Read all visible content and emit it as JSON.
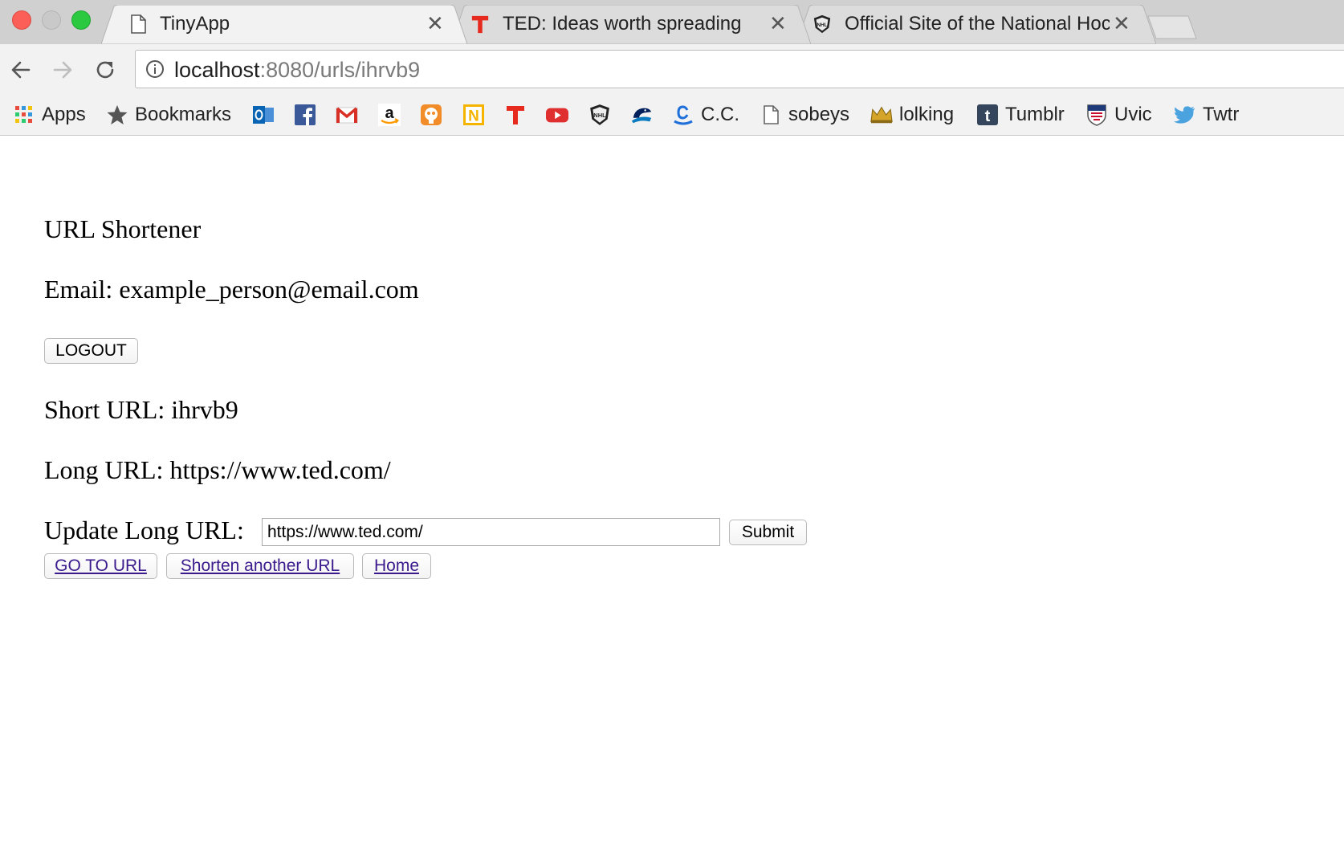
{
  "tabs": [
    {
      "title": "TinyApp",
      "icon": "page-icon",
      "active": true
    },
    {
      "title": "TED: Ideas worth spreading",
      "icon": "ted-icon",
      "active": false
    },
    {
      "title": "Official Site of the National Hoc",
      "icon": "nhl-icon",
      "active": false
    }
  ],
  "address_bar": {
    "host": "localhost",
    "rest": ":8080/urls/ihrvb9"
  },
  "bookmarks": [
    {
      "label": "Apps",
      "icon": "apps-grid-icon"
    },
    {
      "label": "Bookmarks",
      "icon": "star-icon"
    },
    {
      "label": "",
      "icon": "outlook-icon"
    },
    {
      "label": "",
      "icon": "facebook-icon"
    },
    {
      "label": "",
      "icon": "gmail-icon"
    },
    {
      "label": "",
      "icon": "amazon-icon"
    },
    {
      "label": "",
      "icon": "duolingo-icon"
    },
    {
      "label": "",
      "icon": "n-icon"
    },
    {
      "label": "",
      "icon": "ted-icon"
    },
    {
      "label": "",
      "icon": "youtube-icon"
    },
    {
      "label": "",
      "icon": "nhl-icon"
    },
    {
      "label": "",
      "icon": "canucks-icon"
    },
    {
      "label": "C.C.",
      "icon": "cc-icon"
    },
    {
      "label": "sobeys",
      "icon": "page-icon"
    },
    {
      "label": "lolking",
      "icon": "crown-icon"
    },
    {
      "label": "Tumblr",
      "icon": "tumblr-icon"
    },
    {
      "label": "Uvic",
      "icon": "uvic-icon"
    },
    {
      "label": "Twtr",
      "icon": "twitter-icon"
    }
  ],
  "page": {
    "heading": "URL Shortener",
    "email_line": "Email: example_person@email.com",
    "logout_label": "LOGOUT",
    "short_url_line": "Short URL: ihrvb9",
    "long_url_line": "Long URL: https://www.ted.com/",
    "update_label": "Update Long URL:",
    "update_value": "https://www.ted.com/",
    "submit_label": "Submit",
    "goto_label": "GO TO URL",
    "shorten_another_label": "Shorten another URL",
    "home_label": "Home"
  },
  "colors": {
    "link": "#3a1a8c",
    "ted_red": "#e62b1e",
    "tab_active": "#f2f2f2",
    "tab_inactive": "#dcdcdc"
  }
}
